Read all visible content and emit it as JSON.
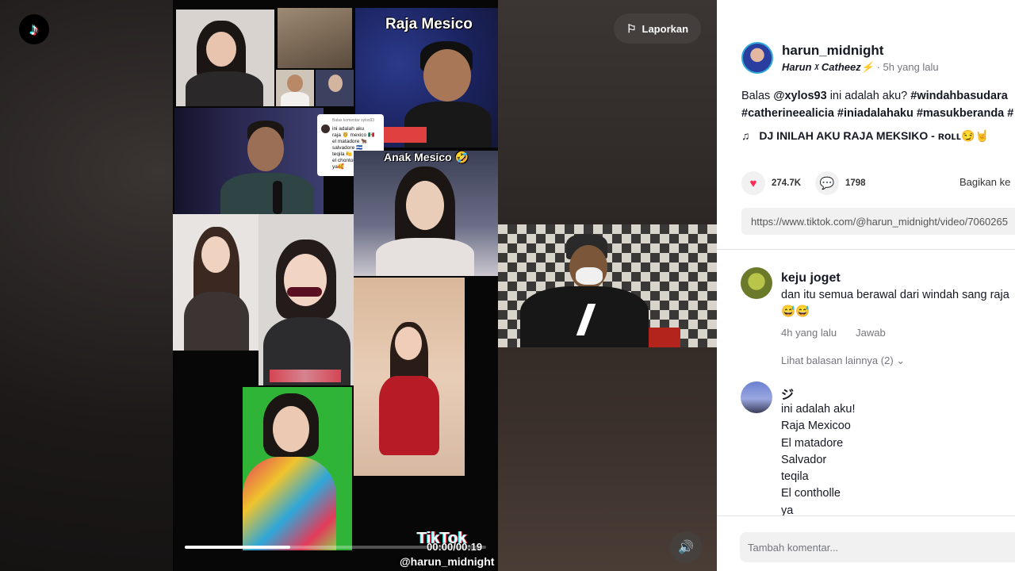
{
  "icons": {
    "tiktok_logo": "tiktok-logo-icon",
    "flag": "flag-icon",
    "volume": "volume-icon",
    "heart": "heart-icon",
    "comment": "comment-icon",
    "music_note": "music-note-icon",
    "chevron": "chevron-down-icon"
  },
  "colors": {
    "accent": "#fe2c55",
    "text": "#161823",
    "muted": "#75767d"
  },
  "header": {
    "report_label": "Laporkan"
  },
  "video": {
    "overlay_title": "Raja Mesico",
    "overlay_subtitle": "Anak Mesico 🤣",
    "reply_note": {
      "header": "Balas komentar xylos93",
      "lines": [
        "ini adalah aku",
        "raja 🤴 mexico 🇲🇽",
        "el matadore 🐂",
        "salvadore 🇸🇻",
        "teqila 🍋",
        "el chontolle 🍌",
        "ya🥰"
      ]
    },
    "timestamp": "00:00/00:19",
    "progress": 0.35,
    "watermark_logo": "TikTok",
    "watermark_user": "@harun_midnight"
  },
  "post": {
    "author_username": "harun_midnight",
    "author_nickname": "Harun ᵡ Catheez⚡",
    "time_ago": "5h yang lalu",
    "caption_prefix": "Balas ",
    "caption_mention": "@xylos93",
    "caption_body": " ini adalah aku? ",
    "caption_tag1": "#windahbasudara",
    "caption_line2": "#catherineealicia #iniadalahaku #masukberanda #",
    "music": "DJ INILAH AKU RAJA MEKSIKO - ʀᴏʟʟ😏🤘",
    "likes": "274.7K",
    "comments": "1798",
    "share_label": "Bagikan ke",
    "link": "https://www.tiktok.com/@harun_midnight/video/7060265"
  },
  "comments": [
    {
      "username": "keju joget",
      "text": "dan itu semua berawal dari windah sang raja",
      "emojis": "😅😅",
      "time": "4h yang lalu",
      "reply_label": "Jawab",
      "more_replies": "Lihat balasan lainnya (2)"
    },
    {
      "username": "ジ",
      "lines": [
        "ini adalah aku!",
        "Raja Mexicoo",
        "El matadore",
        "Salvador",
        "teqila",
        "El contholle",
        "ya"
      ]
    }
  ],
  "composer": {
    "placeholder": "Tambah komentar..."
  }
}
